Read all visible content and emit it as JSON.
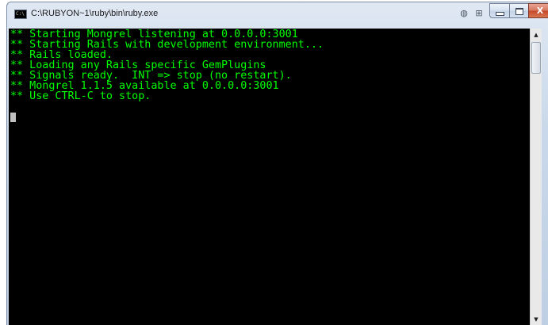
{
  "window": {
    "title": "C:\\RUBYON~1\\ruby\\bin\\ruby.exe",
    "app_icon_text": "C:\\",
    "extra_buttons": [
      "◍",
      "⊞"
    ],
    "controls": {
      "minimize": "",
      "maximize": "",
      "close": "X"
    }
  },
  "console": {
    "text_color": "#00ff00",
    "background_color": "#000000",
    "lines": [
      "** Starting Mongrel listening at 0.0.0.0:3001",
      "** Starting Rails with development environment...",
      "** Rails loaded.",
      "** Loading any Rails specific GemPlugins",
      "** Signals ready.  INT => stop (no restart).",
      "** Mongrel 1.1.5 available at 0.0.0.0:3001",
      "** Use CTRL-C to stop."
    ]
  },
  "scrollbar": {
    "up_arrow": "▲",
    "down_arrow": "▼"
  }
}
